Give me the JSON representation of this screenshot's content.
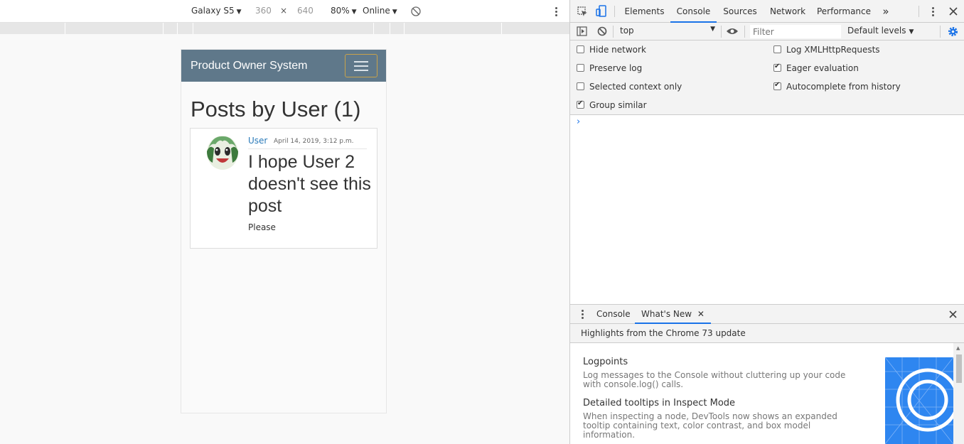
{
  "device_toolbar": {
    "device": "Galaxy S5",
    "width": "360",
    "times": "×",
    "height": "640",
    "zoom": "80%",
    "network": "Online"
  },
  "site": {
    "brand": "Product Owner System",
    "page_heading": "Posts by User (1)",
    "post": {
      "author": "User",
      "date": "April 14, 2019, 3:12 p.m.",
      "title": "I hope User 2 doesn't see this post",
      "body": "Please"
    }
  },
  "devtools": {
    "tabs": [
      "Elements",
      "Console",
      "Sources",
      "Network",
      "Performance"
    ],
    "active_tab": "Console",
    "more_tabs": "»",
    "context": "top",
    "filter_placeholder": "Filter",
    "levels": "Default levels",
    "options_left": [
      {
        "label": "Hide network",
        "checked": false
      },
      {
        "label": "Preserve log",
        "checked": false
      },
      {
        "label": "Selected context only",
        "checked": false
      },
      {
        "label": "Group similar",
        "checked": true
      }
    ],
    "options_right": [
      {
        "label": "Log XMLHttpRequests",
        "checked": false
      },
      {
        "label": "Eager evaluation",
        "checked": true
      },
      {
        "label": "Autocomplete from history",
        "checked": true
      }
    ],
    "prompt": "›",
    "drawer": {
      "tabs": [
        "Console",
        "What's New"
      ],
      "active_tab": "What's New",
      "highlights": "Highlights from the Chrome 73 update",
      "items": [
        {
          "title": "Logpoints",
          "text": "Log messages to the Console without cluttering up your code with console.log() calls."
        },
        {
          "title": "Detailed tooltips in Inspect Mode",
          "text": "When inspecting a node, DevTools now shows an expanded tooltip containing text, color contrast, and box model information."
        }
      ]
    }
  },
  "colors": {
    "navbar": "#5f788a",
    "link": "#2a7ab9",
    "devtools_accent": "#1a73e8",
    "toggler_border": "#c8a24a"
  }
}
